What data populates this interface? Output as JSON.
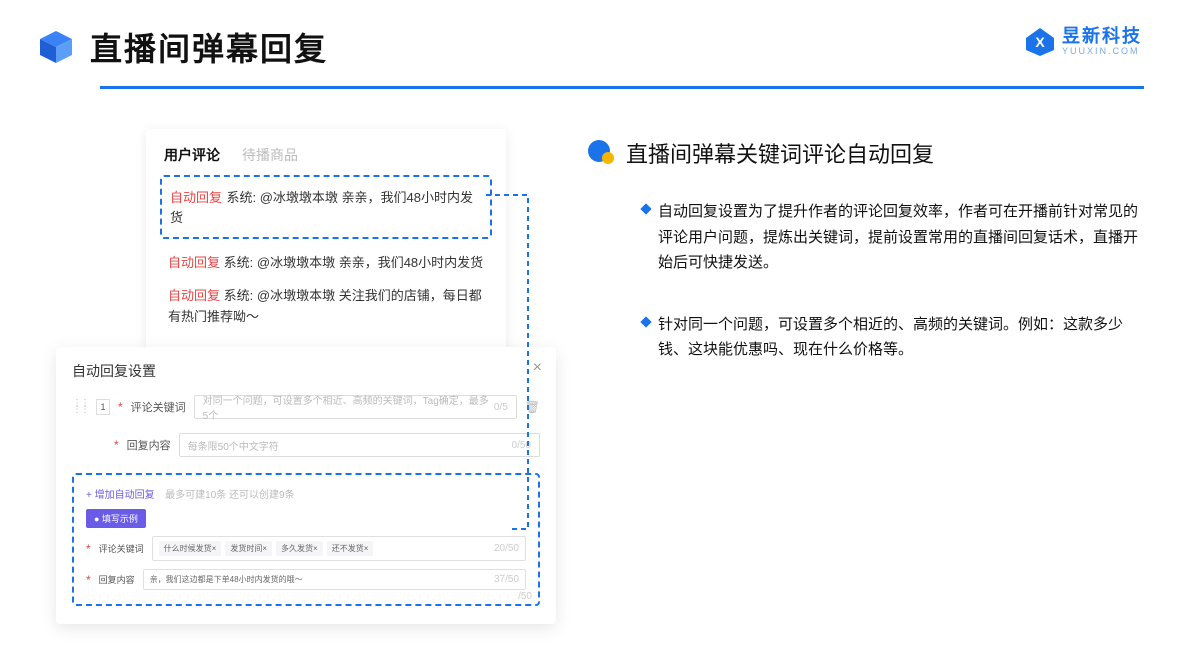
{
  "header": {
    "title": "直播间弹幕回复"
  },
  "brand": {
    "name": "昱新科技",
    "sub": "YUUXIN.COM"
  },
  "card1": {
    "tab_active": "用户评论",
    "tab_inactive": "待播商品",
    "auto_label": "自动回复",
    "sys_prefix": "系统:",
    "msg1": "@冰墩墩本墩 亲亲，我们48小时内发货",
    "msg2": "@冰墩墩本墩 亲亲，我们48小时内发货",
    "msg3": "@冰墩墩本墩 关注我们的店铺，每日都有热门推荐呦～"
  },
  "card2": {
    "title": "自动回复设置",
    "idx": "1",
    "label_keyword": "评论关键词",
    "placeholder_keyword": "对同一个问题，可设置多个相近、高频的关键词，Tag确定，最多5个",
    "counter_kw": "0/5",
    "label_content": "回复内容",
    "placeholder_content": "每条限50个中文字符",
    "counter_ct": "0/50",
    "add_link": "+ 增加自动回复",
    "add_note": "最多可建10条 还可以创建9条",
    "ex_badge": "● 填写示例",
    "ex_kw_label": "评论关键词",
    "ex_tags": [
      "什么时候发货×",
      "发货时间×",
      "多久发货×",
      "还不发货×"
    ],
    "ex_kw_counter": "20/50",
    "ex_ct_label": "回复内容",
    "ex_ct_value": "亲，我们这边都是下单48小时内发货的哦～",
    "ex_ct_counter": "37/50",
    "outer_counter": "/50"
  },
  "right": {
    "title": "直播间弹幕关键词评论自动回复",
    "item1": "自动回复设置为了提升作者的评论回复效率，作者可在开播前针对常见的评论用户问题，提炼出关键词，提前设置常用的直播间回复话术，直播开始后可快捷发送。",
    "item2": "针对同一个问题，可设置多个相近的、高频的关键词。例如：这款多少钱、这块能优惠吗、现在什么价格等。"
  }
}
